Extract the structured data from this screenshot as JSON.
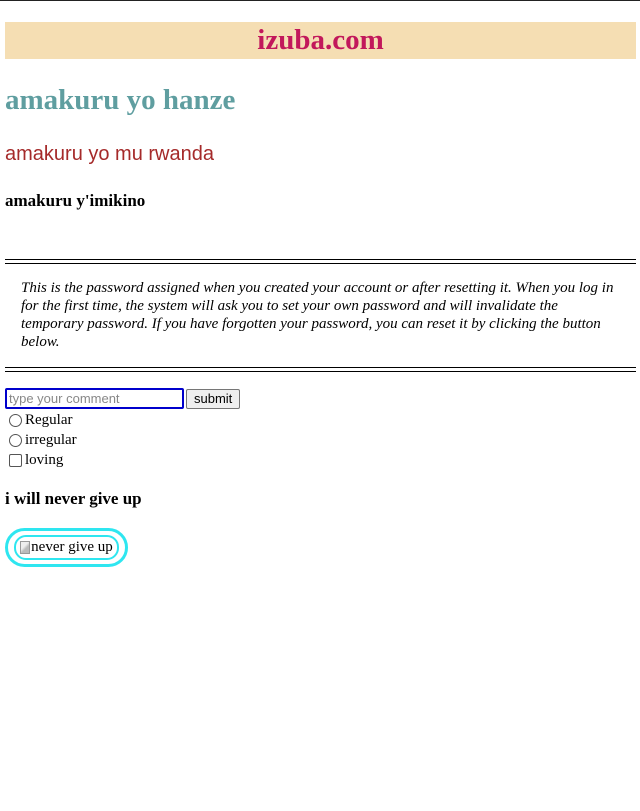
{
  "site": {
    "banner_title": "izuba.com"
  },
  "headings": {
    "world_news": "amakuru yo hanze",
    "rwanda_news": "amakuru yo mu rwanda",
    "sports_news": "amakuru y'imikino"
  },
  "password_note": "This is the password assigned when you created your account or after resetting it. When you log in for the first time, the system will ask you to set your own password and will invalidate the temporary password. If you have forgotten your password, you can reset it by clicking the button below.",
  "comment_form": {
    "input_value": "",
    "input_placeholder": "type your comment",
    "submit_label": "submit",
    "options": [
      {
        "type": "radio",
        "label": "Regular",
        "checked": false
      },
      {
        "type": "radio",
        "label": "irregular",
        "checked": false
      },
      {
        "type": "checkbox",
        "label": "loving",
        "checked": false
      }
    ]
  },
  "motto": {
    "heading": "i will never give up",
    "image_alt": "never give up"
  },
  "colors": {
    "banner_background": "#f5deb3",
    "banner_text": "#c2185b",
    "world_heading": "#5f9ea0",
    "rwanda_heading": "#a52a2a",
    "input_border": "#0000cc",
    "image_border": "#2ee6f0"
  },
  "icons": {
    "broken_image": "broken-image-icon",
    "radio": "radio-button-icon",
    "checkbox": "checkbox-icon"
  }
}
